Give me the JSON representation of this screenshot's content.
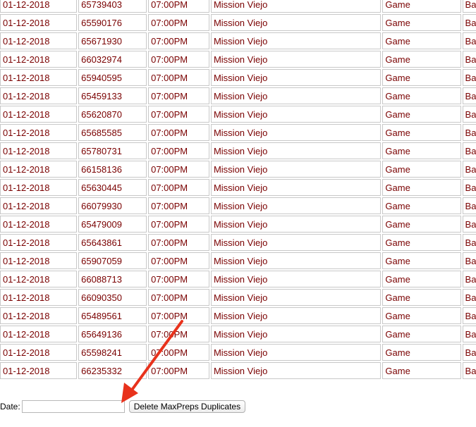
{
  "table": {
    "rows": [
      [
        "01-12-2018",
        "65739403",
        "07:00PM",
        "Mission Viejo",
        "Game",
        "Ba"
      ],
      [
        "01-12-2018",
        "65590176",
        "07:00PM",
        "Mission Viejo",
        "Game",
        "Ba"
      ],
      [
        "01-12-2018",
        "65671930",
        "07:00PM",
        "Mission Viejo",
        "Game",
        "Ba"
      ],
      [
        "01-12-2018",
        "66032974",
        "07:00PM",
        "Mission Viejo",
        "Game",
        "Ba"
      ],
      [
        "01-12-2018",
        "65940595",
        "07:00PM",
        "Mission Viejo",
        "Game",
        "Ba"
      ],
      [
        "01-12-2018",
        "65459133",
        "07:00PM",
        "Mission Viejo",
        "Game",
        "Ba"
      ],
      [
        "01-12-2018",
        "65620870",
        "07:00PM",
        "Mission Viejo",
        "Game",
        "Ba"
      ],
      [
        "01-12-2018",
        "65685585",
        "07:00PM",
        "Mission Viejo",
        "Game",
        "Ba"
      ],
      [
        "01-12-2018",
        "65780731",
        "07:00PM",
        "Mission Viejo",
        "Game",
        "Ba"
      ],
      [
        "01-12-2018",
        "66158136",
        "07:00PM",
        "Mission Viejo",
        "Game",
        "Ba"
      ],
      [
        "01-12-2018",
        "65630445",
        "07:00PM",
        "Mission Viejo",
        "Game",
        "Ba"
      ],
      [
        "01-12-2018",
        "66079930",
        "07:00PM",
        "Mission Viejo",
        "Game",
        "Ba"
      ],
      [
        "01-12-2018",
        "65479009",
        "07:00PM",
        "Mission Viejo",
        "Game",
        "Ba"
      ],
      [
        "01-12-2018",
        "65643861",
        "07:00PM",
        "Mission Viejo",
        "Game",
        "Ba"
      ],
      [
        "01-12-2018",
        "65907059",
        "07:00PM",
        "Mission Viejo",
        "Game",
        "Ba"
      ],
      [
        "01-12-2018",
        "66088713",
        "07:00PM",
        "Mission Viejo",
        "Game",
        "Ba"
      ],
      [
        "01-12-2018",
        "66090350",
        "07:00PM",
        "Mission Viejo",
        "Game",
        "Ba"
      ],
      [
        "01-12-2018",
        "65489561",
        "07:00PM",
        "Mission Viejo",
        "Game",
        "Ba"
      ],
      [
        "01-12-2018",
        "65649136",
        "07:00PM",
        "Mission Viejo",
        "Game",
        "Ba"
      ],
      [
        "01-12-2018",
        "65598241",
        "07:00PM",
        "Mission Viejo",
        "Game",
        "Ba"
      ],
      [
        "01-12-2018",
        "66235332",
        "07:00PM",
        "Mission Viejo",
        "Game",
        "Ba"
      ]
    ]
  },
  "controls": {
    "date_label": "Date:",
    "date_value": "",
    "delete_button_label": "Delete MaxPreps Duplicates"
  },
  "colors": {
    "cell_text": "#7a0000",
    "cell_border": "#c8c8c8",
    "annotation_arrow": "#e8321c"
  },
  "annotation": {
    "icon": "arrow-icon"
  }
}
